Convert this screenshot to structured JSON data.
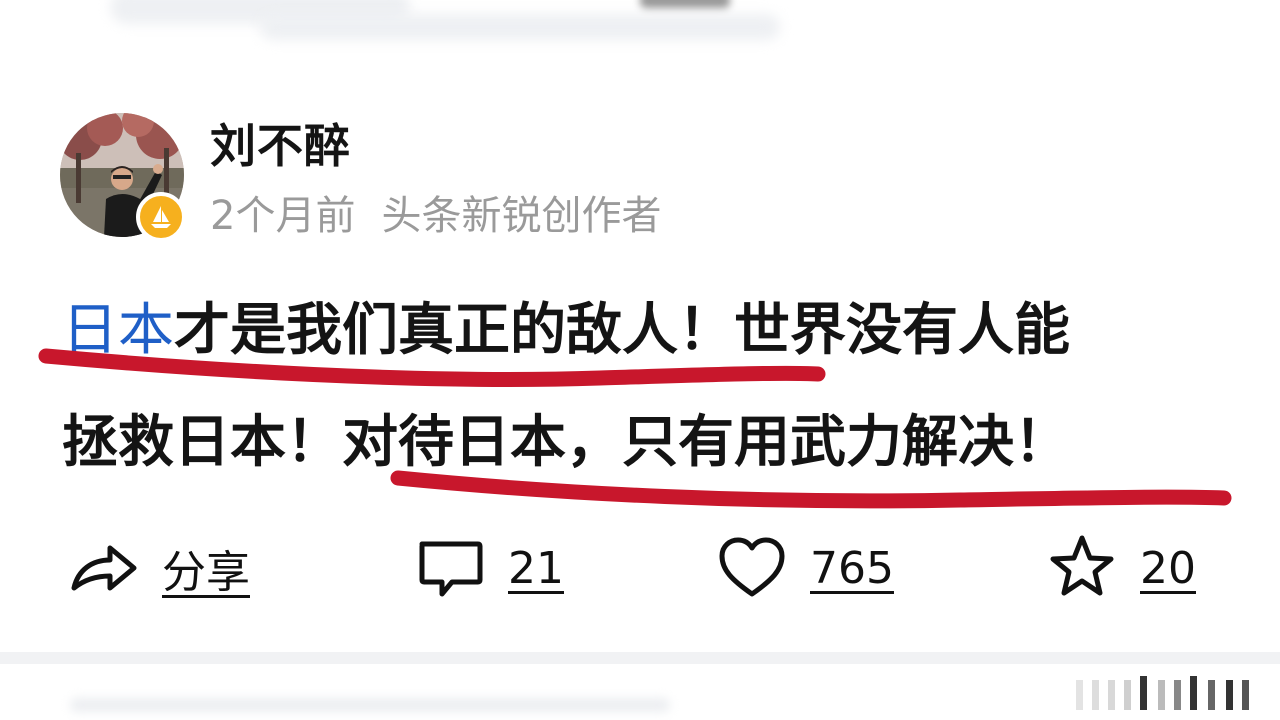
{
  "author": {
    "name": "刘不醉",
    "time": "2个月前",
    "title": "头条新锐创作者",
    "badge_color": "#f6b01e"
  },
  "post": {
    "line1_link": "日本",
    "line1_rest": "才是我们真正的敌人！世界没有人能",
    "line2": "拯救日本！对待日本，只有用武力解决！",
    "link_color": "#1f5fc7",
    "underline_color": "#c8172c"
  },
  "actions": {
    "share": {
      "label": "分享",
      "icon": "share-icon"
    },
    "comment": {
      "label": "21",
      "icon": "comment-icon"
    },
    "like": {
      "label": "765",
      "icon": "heart-icon"
    },
    "favorite": {
      "label": "20",
      "icon": "star-icon"
    }
  }
}
